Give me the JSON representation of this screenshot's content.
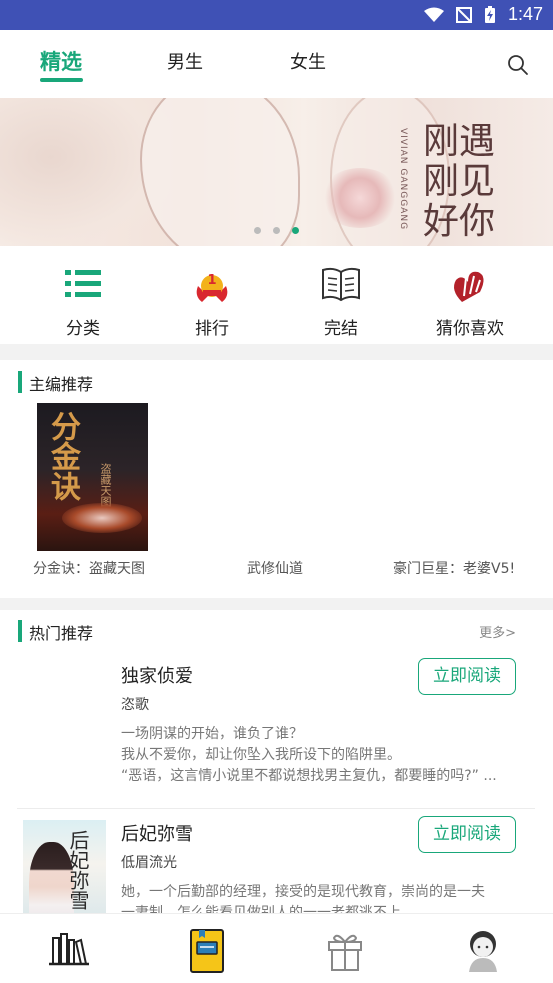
{
  "status_bar": {
    "time": "1:47"
  },
  "top_tabs": [
    "精选",
    "男生",
    "女生"
  ],
  "banner": {
    "title_lines": [
      "刚遇",
      "刚见",
      "好你"
    ],
    "vertical_text": "VIVIAN GANGGANG",
    "dot_count": 3,
    "active_dot": 2
  },
  "quick_nav": [
    {
      "label": "分类",
      "icon": "category-list-icon"
    },
    {
      "label": "排行",
      "icon": "ranking-medal-icon"
    },
    {
      "label": "完结",
      "icon": "open-book-icon"
    },
    {
      "label": "猜你喜欢",
      "icon": "heart-icon"
    }
  ],
  "editor_picks": {
    "title": "主编推荐",
    "cover_title": "分金诀",
    "cover_subtitle": "盗藏天图",
    "books": [
      "分金诀：盗藏天图",
      "武修仙道",
      "豪门巨星：老婆V5!"
    ]
  },
  "hot": {
    "title": "热门推荐",
    "more": "更多>",
    "read_label": "立即阅读",
    "books": [
      {
        "title": "独家侦爱",
        "author": "恣歌",
        "desc": [
          "一场阴谋的开始，谁负了谁？",
          "我从不爱你，却让你坠入我所设下的陷阱里。",
          "“恶语，这言情小说里不都说想找男主复仇，都要睡的吗?” ..."
        ]
      },
      {
        "title": "后妃弥雪",
        "author": "低眉流光",
        "cover_title": "后妃弥雪",
        "desc": [
          "她，一个后勤部的经理，接受的是现代教育，崇尚的是一夫",
          "一妻制，怎么能看见做别人的一一老都逃不上"
        ]
      }
    ]
  },
  "bottom_nav": [
    {
      "icon": "bookshelf-icon"
    },
    {
      "icon": "book-store-icon",
      "active": true
    },
    {
      "icon": "gift-icon"
    },
    {
      "icon": "profile-avatar-icon"
    }
  ],
  "colors": {
    "accent": "#19a77a",
    "status_bar": "#3f51b5"
  }
}
